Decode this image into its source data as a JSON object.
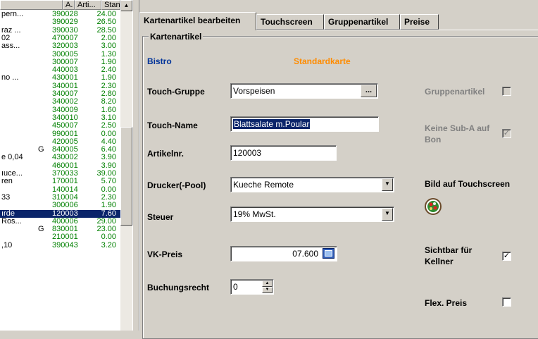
{
  "list": {
    "headers": [
      "",
      "A.",
      "Arti...",
      "Stand..."
    ],
    "rows": [
      {
        "name": "pern...",
        "g": "",
        "nr": "390028",
        "price": "24.00"
      },
      {
        "name": "",
        "g": "",
        "nr": "390029",
        "price": "26.50"
      },
      {
        "name": "raz ...",
        "g": "",
        "nr": "390030",
        "price": "28.50"
      },
      {
        "name": "02",
        "g": "",
        "nr": "470007",
        "price": "2.00"
      },
      {
        "name": "ass...",
        "g": "",
        "nr": "320003",
        "price": "3.00"
      },
      {
        "name": "",
        "g": "",
        "nr": "300005",
        "price": "1.30"
      },
      {
        "name": "",
        "g": "",
        "nr": "300007",
        "price": "1.90"
      },
      {
        "name": "",
        "g": "",
        "nr": "440003",
        "price": "2.40"
      },
      {
        "name": "no ...",
        "g": "",
        "nr": "430001",
        "price": "1.90"
      },
      {
        "name": "",
        "g": "",
        "nr": "340001",
        "price": "2.30"
      },
      {
        "name": "",
        "g": "",
        "nr": "340007",
        "price": "2.80"
      },
      {
        "name": "",
        "g": "",
        "nr": "340002",
        "price": "8.20"
      },
      {
        "name": "",
        "g": "",
        "nr": "340009",
        "price": "1.60"
      },
      {
        "name": "",
        "g": "",
        "nr": "340010",
        "price": "3.10"
      },
      {
        "name": "",
        "g": "",
        "nr": "450007",
        "price": "2.50"
      },
      {
        "name": "",
        "g": "",
        "nr": "990001",
        "price": "0.00"
      },
      {
        "name": "",
        "g": "",
        "nr": "420005",
        "price": "4.40"
      },
      {
        "name": "",
        "g": "G",
        "nr": "840005",
        "price": "6.40"
      },
      {
        "name": "e 0,04",
        "g": "",
        "nr": "430002",
        "price": "3.90"
      },
      {
        "name": "",
        "g": "",
        "nr": "460001",
        "price": "3.90"
      },
      {
        "name": "ıuce...",
        "g": "",
        "nr": "370033",
        "price": "39.00"
      },
      {
        "name": "ren",
        "g": "",
        "nr": "170001",
        "price": "5.70"
      },
      {
        "name": "",
        "g": "",
        "nr": "140014",
        "price": "0.00"
      },
      {
        "name": "33",
        "g": "",
        "nr": "310004",
        "price": "2.30"
      },
      {
        "name": "",
        "g": "",
        "nr": "300006",
        "price": "1.90"
      },
      {
        "name": "ırde",
        "g": "",
        "nr": "120003",
        "price": "7.60",
        "selected": true
      },
      {
        "name": "Ros...",
        "g": "",
        "nr": "400006",
        "price": "29.00"
      },
      {
        "name": "",
        "g": "G",
        "nr": "830001",
        "price": "23.00"
      },
      {
        "name": "",
        "g": "",
        "nr": "210001",
        "price": "0.00"
      },
      {
        "name": ",10",
        "g": "",
        "nr": "390043",
        "price": "3.20"
      }
    ]
  },
  "tabs": [
    "Kartenartikel bearbeiten",
    "Touchscreen",
    "Gruppenartikel",
    "Preise"
  ],
  "form": {
    "group_title": "Kartenartikel",
    "outlet": "Bistro",
    "card": "Standardkarte",
    "touch_gruppe_label": "Touch-Gruppe",
    "touch_gruppe_value": "Vorspeisen",
    "browse_btn": "...",
    "touch_name_label": "Touch-Name",
    "touch_name_value": "Blattsalate m.Poular",
    "artikelnr_label": "Artikelnr.",
    "artikelnr_value": "120003",
    "drucker_label": "Drucker(-Pool)",
    "drucker_value": "Kueche Remote",
    "steuer_label": "Steuer",
    "steuer_value": "19% MwSt.",
    "vk_label": "VK-Preis",
    "vk_value": "07.600",
    "buchungsrecht_label": "Buchungsrecht",
    "buchungsrecht_value": "0",
    "gruppenartikel_label": "Gruppenartikel",
    "keine_sub_label1": "Keine Sub-A auf",
    "keine_sub_label2": "Bon",
    "bild_label": "Bild auf Touchscreen",
    "sichtbar_label1": "Sichtbar für",
    "sichtbar_label2": "Kellner",
    "sichtbar_checked": "✓",
    "keine_sub_checked": "✓",
    "flex_label": "Flex. Preis"
  },
  "colors": {
    "outlet": "#003399",
    "card": "#ff8c00",
    "green": "#008000",
    "select": "#0a246a"
  }
}
